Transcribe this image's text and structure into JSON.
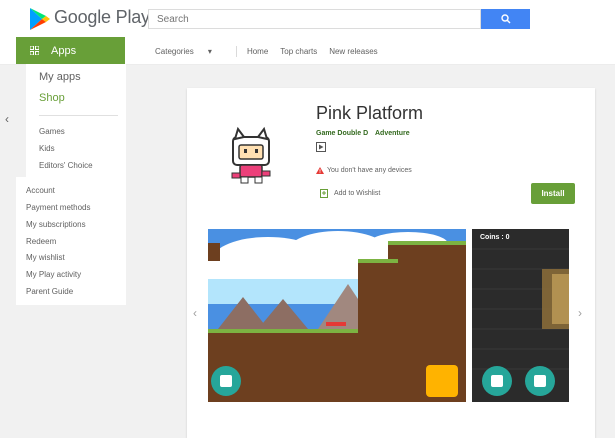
{
  "header": {
    "logo_text": "Google Play",
    "search_placeholder": "Search"
  },
  "nav": {
    "apps_label": "Apps",
    "categories": "Categories",
    "home": "Home",
    "top_charts": "Top charts",
    "new_releases": "New releases"
  },
  "sidebar": {
    "my_apps": "My apps",
    "shop": "Shop",
    "categories": [
      "Games",
      "Kids",
      "Editors' Choice"
    ],
    "account_links": [
      "Account",
      "Payment methods",
      "My subscriptions",
      "Redeem",
      "My wishlist",
      "My Play activity",
      "Parent Guide"
    ]
  },
  "app": {
    "title": "Pink Platform",
    "developer": "Game Double D",
    "genre": "Adventure",
    "warning": "You don't have any devices",
    "wishlist_label": "Add to Wishlist",
    "install_label": "Install"
  },
  "screenshots": {
    "coins_label": "Coins : 0"
  },
  "colors": {
    "brand_green": "#689f38",
    "search_blue": "#4285f4",
    "dev_green": "#33691e"
  }
}
